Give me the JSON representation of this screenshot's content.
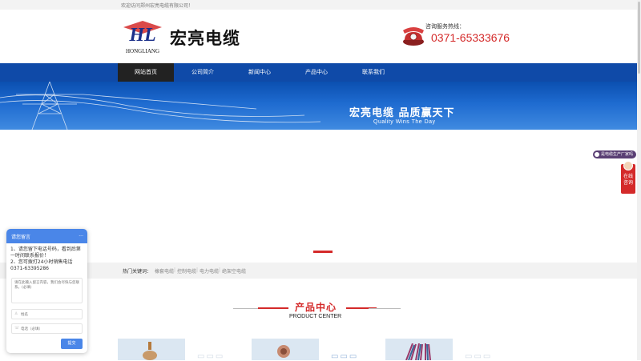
{
  "topbar": {
    "welcome": "欢迎访问郑州宏亮电缆有限公司！"
  },
  "header": {
    "logo_letters": "HL",
    "logo_text": "HONGLIANG",
    "brand": "宏亮电缆",
    "hotline_label": "咨询服务热线：",
    "hotline_number": "0371-65333676"
  },
  "nav": {
    "items": [
      "网站首页",
      "公司简介",
      "新闻中心",
      "产品中心",
      "联系我们"
    ],
    "active": 0
  },
  "banner": {
    "title": "宏亮电缆  品质赢天下",
    "subtitle": "Quality Wins The Day"
  },
  "keywords": {
    "label": "热门关键词：",
    "items": [
      "橡套电缆",
      "控制电缆",
      "电力电缆",
      "绝架空电缆"
    ]
  },
  "products_section": {
    "title": "产品中心",
    "subtitle": "PRODUCT CENTER"
  },
  "sidebar": {
    "badge": "是电缆生产厂家吗",
    "service": "在线咨询"
  },
  "chat": {
    "title": "请您留言",
    "minimize": "...",
    "message_1": "1、请您留下电话号码，看到后第一时间联系报价！",
    "message_2": "2、您可拨打24小时销售电话0371-63395286",
    "textarea_placeholder": "请在此输入留言内容，我们会尽快与您联系。(必填)",
    "name_placeholder": "姓名",
    "phone_placeholder": "电话（必填）",
    "submit": "提交"
  },
  "colors": {
    "nav_blue": "#0f4aa8",
    "accent_red": "#d42a2a",
    "chat_blue": "#4a86e8"
  }
}
